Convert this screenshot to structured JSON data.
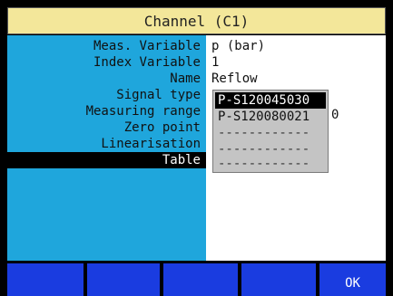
{
  "window": {
    "title": "Channel (C1)"
  },
  "fields": [
    {
      "label": "Meas. Variable",
      "value": "p (bar)"
    },
    {
      "label": "Index Variable",
      "value": "1"
    },
    {
      "label": "Name",
      "value": "Reflow"
    },
    {
      "label": "Signal type",
      "value": ""
    },
    {
      "label": "Measuring range",
      "value": ""
    },
    {
      "label": "Zero point",
      "value": ""
    },
    {
      "label": "Linearisation",
      "value": ""
    },
    {
      "label": "Table",
      "value": ""
    }
  ],
  "dropdown": {
    "options": [
      "P-S120045030",
      "P-S120080021",
      "------------",
      "------------",
      "------------"
    ],
    "selected_index": 0,
    "trailing_value": "0"
  },
  "function_keys": [
    "",
    "",
    "",
    "",
    "OK"
  ],
  "colors": {
    "title_bg": "#f3e79a",
    "label_panel": "#1fa6dc",
    "value_panel": "#ffffff",
    "dropdown_bg": "#c4c4c4",
    "fkey_bg": "#1a3ce0"
  }
}
